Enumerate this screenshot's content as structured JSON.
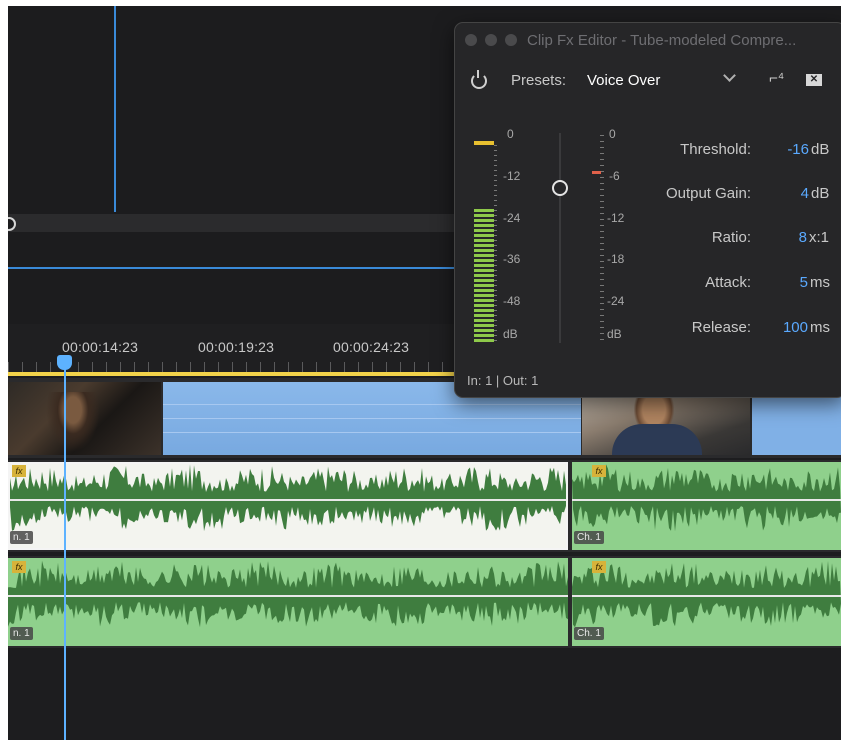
{
  "ruler": {
    "timecodes": [
      "00:00:14:23",
      "00:00:19:23",
      "00:00:24:23"
    ]
  },
  "tracks": {
    "channel_label": "Ch. 1",
    "channel_label_cut": "n. 1",
    "fx_badge": "fx"
  },
  "editor": {
    "title": "Clip Fx Editor - Tube-modeled Compre...",
    "presets_label": "Presets:",
    "presets_value": "Voice Over",
    "input_scale": [
      "0",
      "-12",
      "-24",
      "-36",
      "-48",
      "dB"
    ],
    "output_scale": [
      "0",
      "-6",
      "-12",
      "-18",
      "-24",
      "dB"
    ],
    "params": [
      {
        "label": "Threshold:",
        "value": "-16",
        "unit": "dB"
      },
      {
        "label": "Output Gain:",
        "value": "4",
        "unit": "dB"
      },
      {
        "label": "Ratio:",
        "value": "8",
        "unit": "x:1"
      },
      {
        "label": "Attack:",
        "value": "5",
        "unit": "ms"
      },
      {
        "label": "Release:",
        "value": "100",
        "unit": "ms"
      }
    ],
    "status": "In: 1 | Out: 1"
  },
  "colors": {
    "playhead": "#5db2ff",
    "waveform": "#3f7d3f",
    "waveform_bg_selected": "#f3f4ef",
    "waveform_bg": "#8fd08c",
    "param_value": "#5aa9ff",
    "meter_green": "#8ec94a",
    "meter_peak": "#e8c030"
  },
  "icons": [
    "power-icon",
    "chevron-down-icon",
    "preset-save-icon",
    "preset-delete-icon",
    "playhead-icon"
  ]
}
